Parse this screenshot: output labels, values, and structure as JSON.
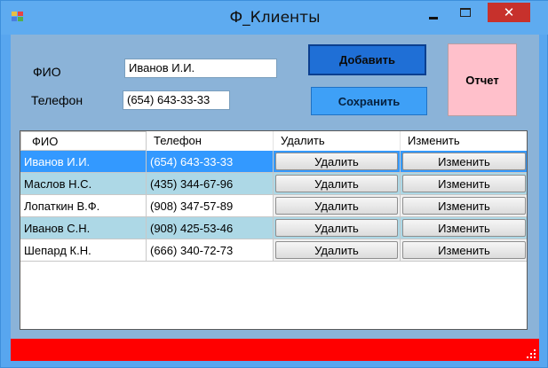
{
  "window": {
    "title": "Ф_Клиенты",
    "close_glyph": "✕",
    "icon": "app-icon",
    "colors": {
      "frame": "#58a6ef",
      "client": "#8bb3d8",
      "status_bar": "#ff0000"
    }
  },
  "form": {
    "fio_label": "ФИО",
    "fio_value": "Иванов И.И.",
    "phone_label": "Телефон",
    "phone_value": "(654) 643-33-33"
  },
  "buttons": {
    "add": "Добавить",
    "save": "Сохранить",
    "report": "Отчет"
  },
  "grid": {
    "columns": [
      "ФИО",
      "Телефон",
      "Удалить",
      "Изменить"
    ],
    "rows": [
      {
        "fio": "Иванов И.И.",
        "phone": "(654) 643-33-33",
        "delete": "Удалить",
        "edit": "Изменить",
        "state": "selected"
      },
      {
        "fio": "Маслов Н.С.",
        "phone": "(435) 344-67-96",
        "delete": "Удалить",
        "edit": "Изменить",
        "state": "alt"
      },
      {
        "fio": "Лопаткин В.Ф.",
        "phone": "(908) 347-57-89",
        "delete": "Удалить",
        "edit": "Изменить",
        "state": "normal"
      },
      {
        "fio": "Иванов С.Н.",
        "phone": "(908) 425-53-46",
        "delete": "Удалить",
        "edit": "Изменить",
        "state": "alt"
      },
      {
        "fio": "Шепард К.Н.",
        "phone": "(666) 340-72-73",
        "delete": "Удалить",
        "edit": "Изменить",
        "state": "normal"
      }
    ]
  }
}
